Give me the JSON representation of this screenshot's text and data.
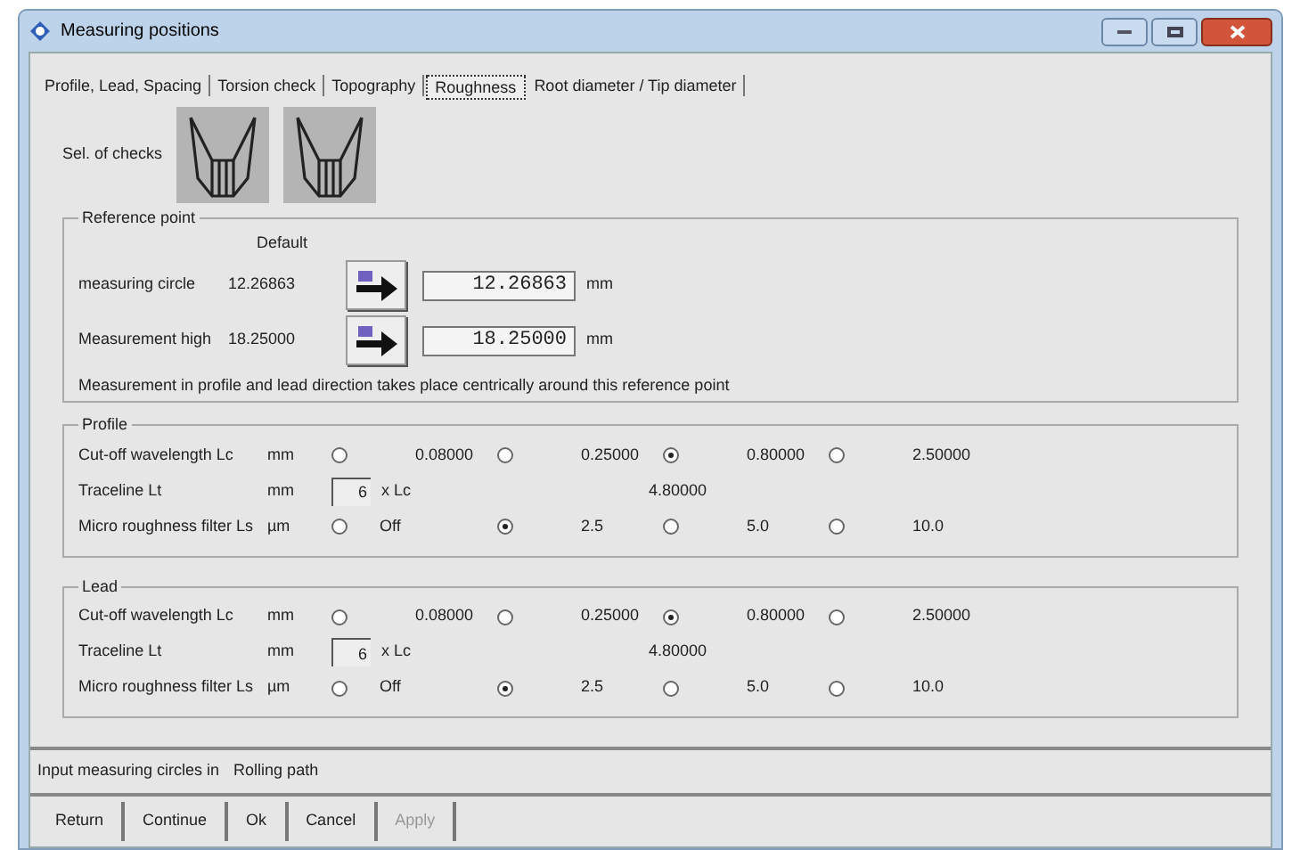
{
  "window": {
    "title": "Measuring positions"
  },
  "tabs": [
    {
      "label": "Profile, Lead, Spacing",
      "selected": false
    },
    {
      "label": "Torsion check",
      "selected": false
    },
    {
      "label": "Topography",
      "selected": false
    },
    {
      "label": "Roughness",
      "selected": true
    },
    {
      "label": "Root diameter / Tip diameter",
      "selected": false
    }
  ],
  "checks": {
    "label": "Sel. of checks"
  },
  "reference_point": {
    "title": "Reference point",
    "default_header": "Default",
    "rows": [
      {
        "label": "measuring circle",
        "default": "12.26863",
        "value": "12.26863",
        "unit": "mm"
      },
      {
        "label": "Measurement high",
        "default": "18.25000",
        "value": "18.25000",
        "unit": "mm"
      }
    ],
    "note": "Measurement in profile and lead direction takes place centrically  around this reference point"
  },
  "groups": [
    {
      "title": "Profile",
      "rows": [
        {
          "kind": "radio",
          "label": "Cut-off wavelength Lc",
          "unit": "mm",
          "options": [
            {
              "label": "0.08000",
              "selected": false
            },
            {
              "label": "0.25000",
              "selected": false
            },
            {
              "label": "0.80000",
              "selected": true
            },
            {
              "label": "2.50000",
              "selected": false
            }
          ]
        },
        {
          "kind": "traceline",
          "label": "Traceline Lt",
          "unit": "mm",
          "value": "6",
          "suffix": "x Lc",
          "result": "4.80000"
        },
        {
          "kind": "radio",
          "label": "Micro roughness filter Ls",
          "unit": "µm",
          "options": [
            {
              "label": "Off",
              "selected": false
            },
            {
              "label": "2.5",
              "selected": true
            },
            {
              "label": "5.0",
              "selected": false
            },
            {
              "label": "10.0",
              "selected": false
            }
          ]
        }
      ]
    },
    {
      "title": "Lead",
      "rows": [
        {
          "kind": "radio",
          "label": "Cut-off wavelength Lc",
          "unit": "mm",
          "options": [
            {
              "label": "0.08000",
              "selected": false
            },
            {
              "label": "0.25000",
              "selected": false
            },
            {
              "label": "0.80000",
              "selected": true
            },
            {
              "label": "2.50000",
              "selected": false
            }
          ]
        },
        {
          "kind": "traceline",
          "label": "Traceline Lt",
          "unit": "mm",
          "value": "6",
          "suffix": "x Lc",
          "result": "4.80000"
        },
        {
          "kind": "radio",
          "label": "Micro roughness filter Ls",
          "unit": "µm",
          "options": [
            {
              "label": "Off",
              "selected": false
            },
            {
              "label": "2.5",
              "selected": true
            },
            {
              "label": "5.0",
              "selected": false
            },
            {
              "label": "10.0",
              "selected": false
            }
          ]
        }
      ]
    }
  ],
  "status": {
    "label": "Input measuring circles in",
    "value": "Rolling path"
  },
  "buttons": [
    {
      "label": "Return",
      "disabled": false
    },
    {
      "label": "Continue",
      "disabled": false
    },
    {
      "label": "Ok",
      "disabled": false
    },
    {
      "label": "Cancel",
      "disabled": false
    },
    {
      "label": "Apply",
      "disabled": true
    }
  ]
}
